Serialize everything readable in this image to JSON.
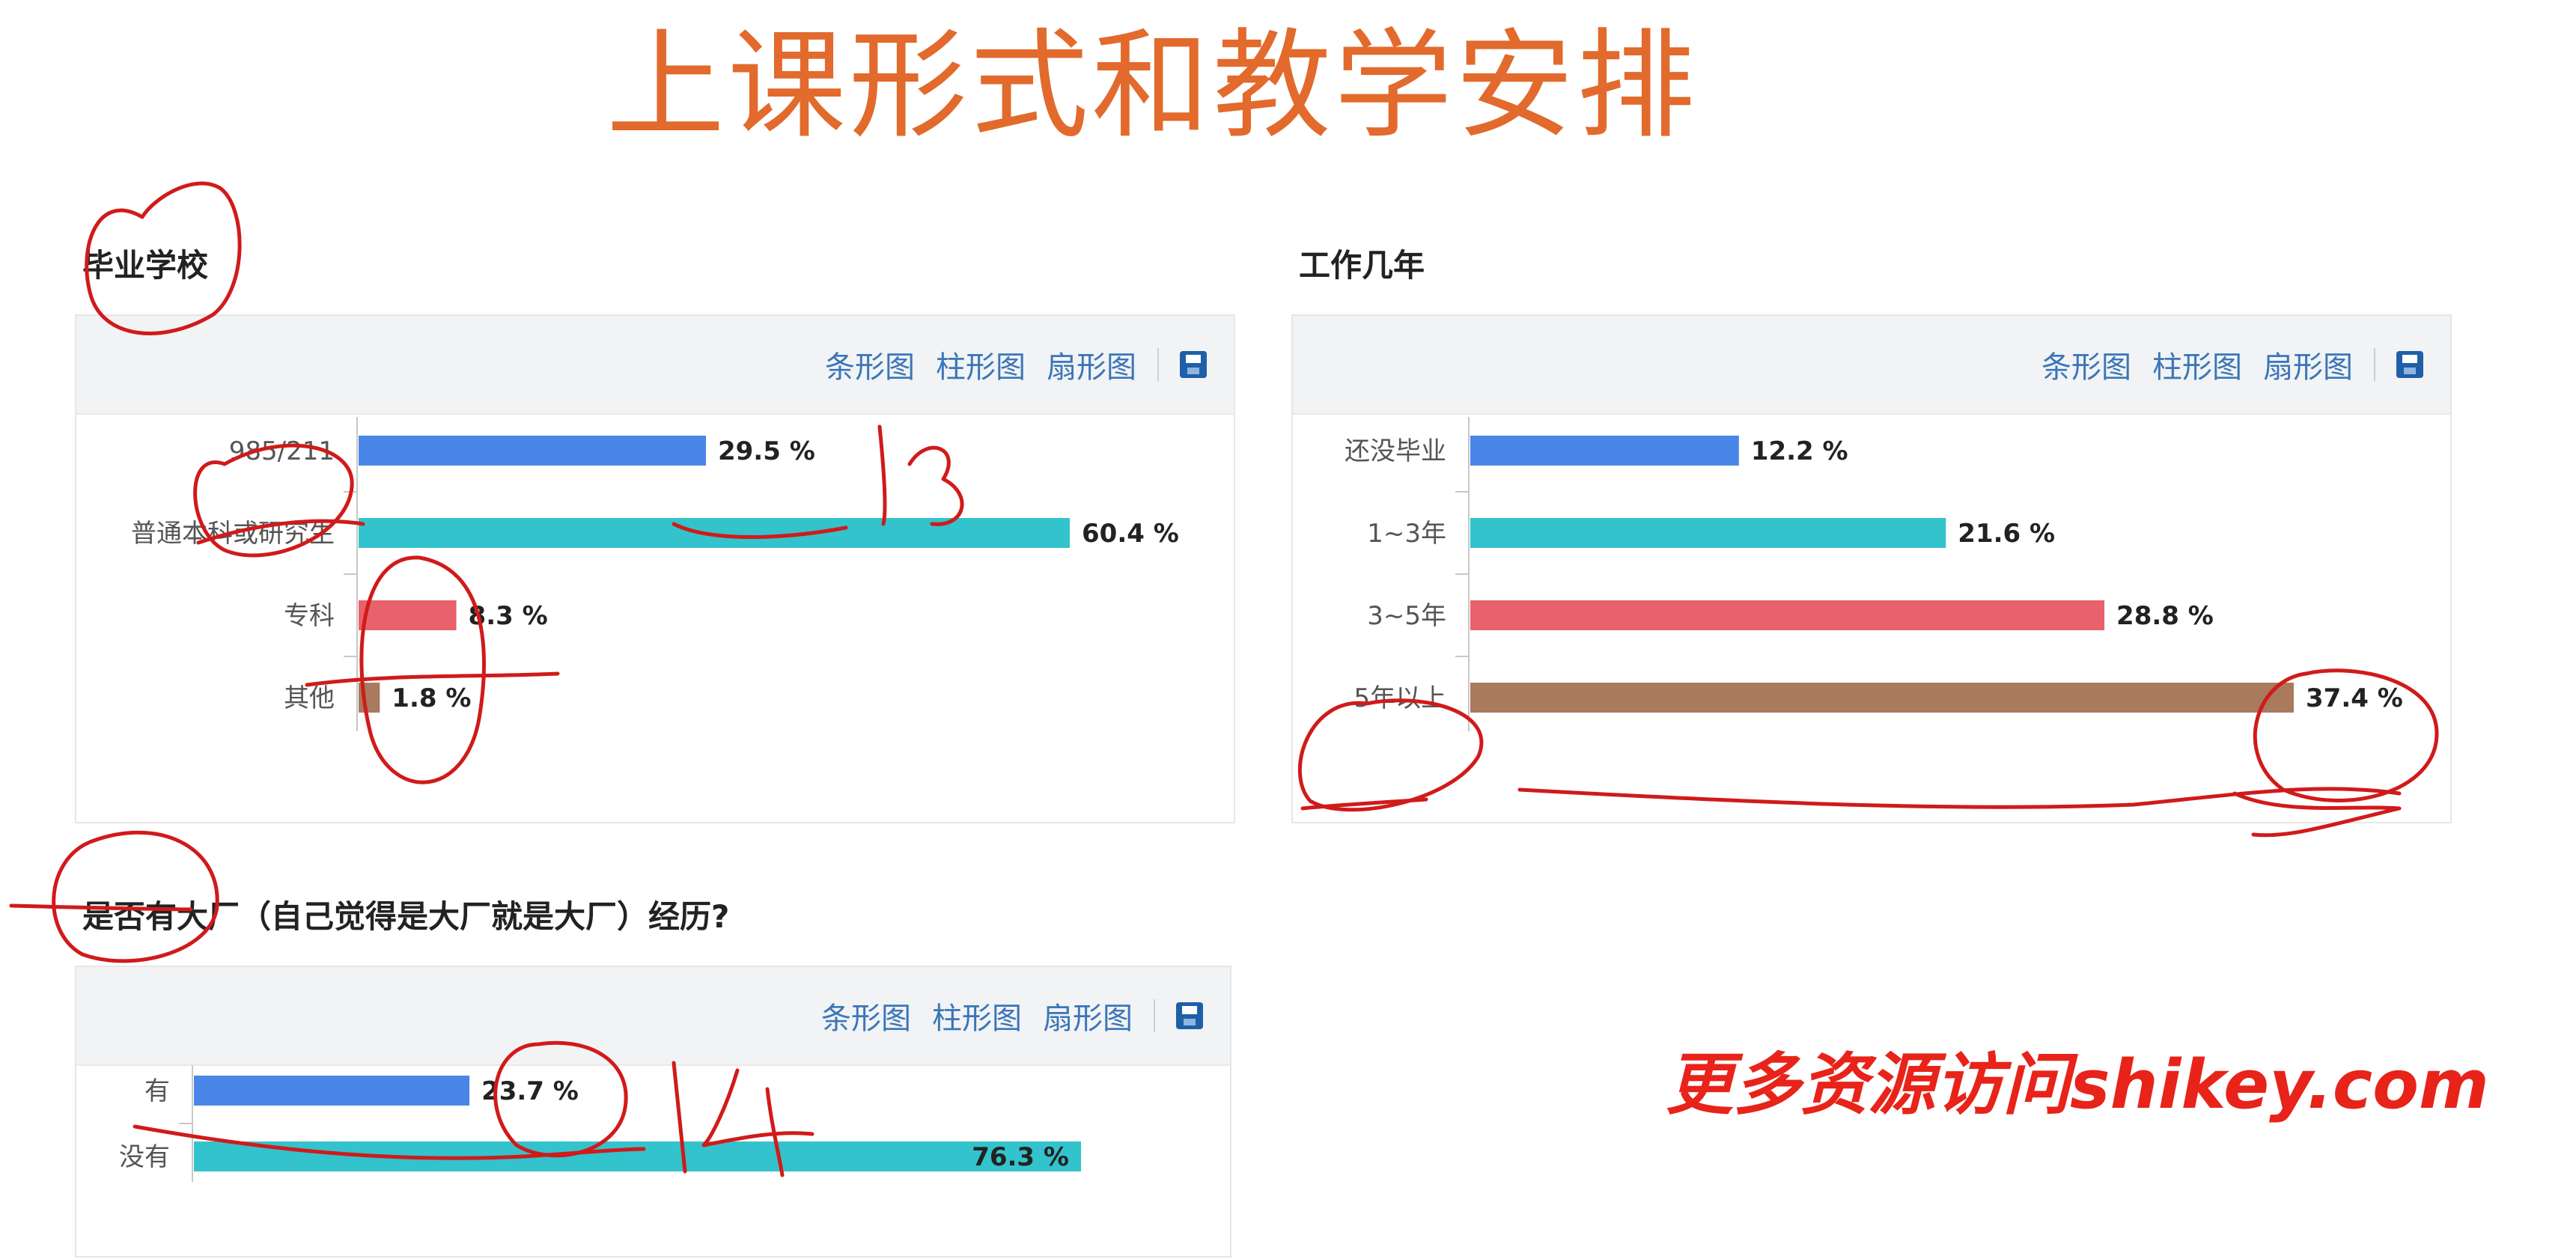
{
  "slide": {
    "title": "上课形式和教学安排"
  },
  "toolbar": {
    "bar_label": "条形图",
    "column_label": "柱形图",
    "pie_label": "扇形图",
    "save_icon": "save-icon"
  },
  "watermark": {
    "text": "更多资源访问shikey.com"
  },
  "colors": {
    "series": [
      "#4a86e8",
      "#33c3cc",
      "#e8626b",
      "#a97a5e"
    ],
    "title": "#e26a2c",
    "toolbar_text": "#3a76b8",
    "watermark": "#e8231a",
    "annotation": "#d11a1a"
  },
  "chart_data": [
    {
      "type": "bar",
      "orientation": "horizontal",
      "title": "毕业学校",
      "categories": [
        "985/211",
        "普通本科或研究生",
        "专科",
        "其他"
      ],
      "values": [
        29.5,
        60.4,
        8.3,
        1.8
      ],
      "value_labels": [
        "29.5 %",
        "60.4 %",
        "8.3 %",
        "1.8 %"
      ],
      "unit": "%",
      "grid": false
    },
    {
      "type": "bar",
      "orientation": "horizontal",
      "title": "工作几年",
      "categories": [
        "还没毕业",
        "1~3年",
        "3~5年",
        "5年以上"
      ],
      "values": [
        12.2,
        21.6,
        28.8,
        37.4
      ],
      "value_labels": [
        "12.2 %",
        "21.6 %",
        "28.8 %",
        "37.4 %"
      ],
      "unit": "%",
      "grid": false
    },
    {
      "type": "bar",
      "orientation": "horizontal",
      "title": "是否有大厂（自己觉得是大厂就是大厂）经历?",
      "categories": [
        "有",
        "没有"
      ],
      "values": [
        23.7,
        76.3
      ],
      "value_labels": [
        "23.7 %",
        "76.3 %"
      ],
      "unit": "%",
      "grid": false
    }
  ]
}
